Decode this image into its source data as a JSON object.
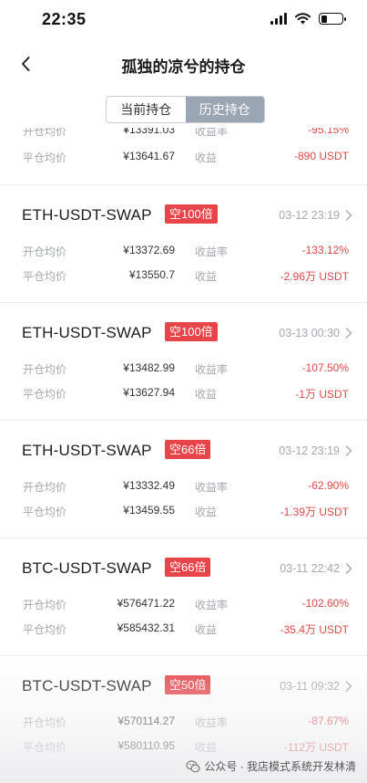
{
  "status_bar": {
    "time": "22:35"
  },
  "nav": {
    "title": "孤独的凉兮的持仓"
  },
  "segment": {
    "current_label": "当前持仓",
    "history_label": "历史持仓"
  },
  "partial_item": {
    "open_label": "开仓均价",
    "open_value": "¥13391.03",
    "rate_label": "收益率",
    "rate_value": "-95.15%",
    "close_label": "平仓均价",
    "close_value": "¥13641.67",
    "profit_label": "收益",
    "profit_value": "-890 USDT"
  },
  "positions": [
    {
      "pair": "ETH-USDT-SWAP",
      "badge": "空100倍",
      "date": "03-12 23:19",
      "open_label": "开仓均价",
      "open_value": "¥13372.69",
      "rate_label": "收益率",
      "rate_value": "-133.12%",
      "close_label": "平仓均价",
      "close_value": "¥13550.7",
      "profit_label": "收益",
      "profit_value": "-2.96万 USDT"
    },
    {
      "pair": "ETH-USDT-SWAP",
      "badge": "空100倍",
      "date": "03-13 00:30",
      "open_label": "开仓均价",
      "open_value": "¥13482.99",
      "rate_label": "收益率",
      "rate_value": "-107.50%",
      "close_label": "平仓均价",
      "close_value": "¥13627.94",
      "profit_label": "收益",
      "profit_value": "-1万 USDT"
    },
    {
      "pair": "ETH-USDT-SWAP",
      "badge": "空66倍",
      "date": "03-12 23:19",
      "open_label": "开仓均价",
      "open_value": "¥13332.49",
      "rate_label": "收益率",
      "rate_value": "-62.90%",
      "close_label": "平仓均价",
      "close_value": "¥13459.55",
      "profit_label": "收益",
      "profit_value": "-1.39万 USDT"
    },
    {
      "pair": "BTC-USDT-SWAP",
      "badge": "空66倍",
      "date": "03-11 22:42",
      "open_label": "开仓均价",
      "open_value": "¥576471.22",
      "rate_label": "收益率",
      "rate_value": "-102.60%",
      "close_label": "平仓均价",
      "close_value": "¥585432.31",
      "profit_label": "收益",
      "profit_value": "-35.4万 USDT"
    },
    {
      "pair": "BTC-USDT-SWAP",
      "badge": "空50倍",
      "date": "03-11 09:32",
      "open_label": "开仓均价",
      "open_value": "¥570114.27",
      "rate_label": "收益率",
      "rate_value": "-87.67%",
      "close_label": "平仓均价",
      "close_value": "¥580110.95",
      "profit_label": "收益",
      "profit_value": "-112万 USDT"
    }
  ],
  "watermark": {
    "text": "公众号 · 我店模式系统开发林清"
  },
  "colors": {
    "loss": "#e04848",
    "badge": "#e8454a",
    "segment_active": "#9aa6b4"
  }
}
